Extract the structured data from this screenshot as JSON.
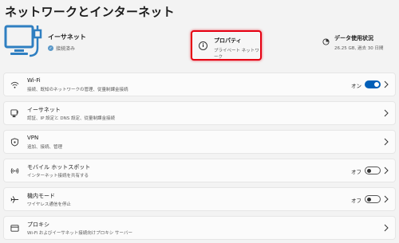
{
  "page": {
    "title": "ネットワークとインターネット"
  },
  "header": {
    "connection_name": "イーサネット",
    "connection_status": "接続済み",
    "properties_title": "プロパティ",
    "properties_sub": "プライベート ネットワーク",
    "usage_title": "データ使用状況",
    "usage_sub": "26.25 GB, 過去 30 日間"
  },
  "rows": [
    {
      "title": "Wi-Fi",
      "sub": "接続、既知のネットワークの管理、従量制課金接続",
      "toggle": "on",
      "toggle_label": "オン"
    },
    {
      "title": "イーサネット",
      "sub": "認証、IP 設定と DNS 設定、従量制課金接続"
    },
    {
      "title": "VPN",
      "sub": "追加、接続、管理"
    },
    {
      "title": "モバイル ホットスポット",
      "sub": "インターネット接続を共有する",
      "toggle": "off",
      "toggle_label": "オフ"
    },
    {
      "title": "機内モード",
      "sub": "ワイヤレス通信を停止",
      "toggle": "off",
      "toggle_label": "オフ"
    },
    {
      "title": "プロキシ",
      "sub": "Wi-Fi およびイーサネット接続向けプロキシ サーバー"
    }
  ],
  "colors": {
    "accent": "#005fb8",
    "highlight_border": "#e60012",
    "monitor_icon": "#2f7fc1"
  },
  "icons": [
    "monitor-ethernet-icon",
    "info-icon",
    "pie-chart-icon",
    "wifi-icon",
    "ethernet-icon",
    "shield-icon",
    "hotspot-icon",
    "airplane-icon",
    "globe-icon",
    "chevron-right-icon"
  ]
}
